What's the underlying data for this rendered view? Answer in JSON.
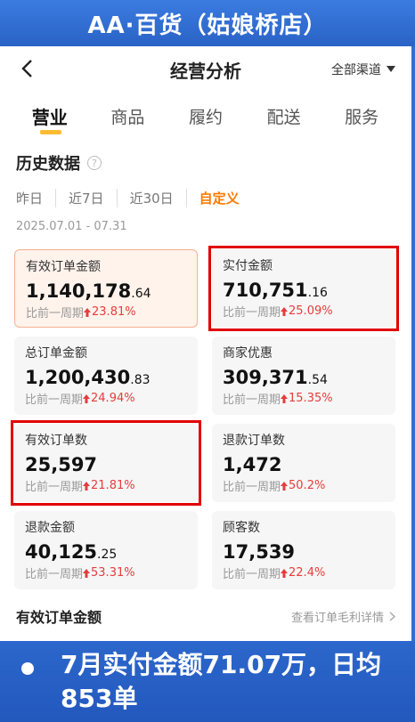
{
  "banner": {
    "title": "AA·百货（姑娘桥店）"
  },
  "nav": {
    "title": "经营分析",
    "channel": "全部渠道"
  },
  "tabs": [
    {
      "label": "营业",
      "active": true
    },
    {
      "label": "商品",
      "active": false
    },
    {
      "label": "履约",
      "active": false
    },
    {
      "label": "配送",
      "active": false
    },
    {
      "label": "服务",
      "active": false
    }
  ],
  "history": {
    "title": "历史数据",
    "ranges": [
      "昨日",
      "近7日",
      "近30日",
      "自定义"
    ],
    "active_range": "自定义",
    "date_range": "2025.07.01 - 07.31"
  },
  "compare_prefix": "比前一周期",
  "metrics": [
    {
      "label": "有效订单金额",
      "value": "1,140,178",
      "decimal": ".64",
      "change": "23.81%"
    },
    {
      "label": "实付金额",
      "value": "710,751",
      "decimal": ".16",
      "change": "25.09%"
    },
    {
      "label": "总订单金额",
      "value": "1,200,430",
      "decimal": ".83",
      "change": "24.94%"
    },
    {
      "label": "商家优惠",
      "value": "309,371",
      "decimal": ".54",
      "change": "15.35%"
    },
    {
      "label": "有效订单数",
      "value": "25,597",
      "decimal": "",
      "change": "21.81%"
    },
    {
      "label": "退款订单数",
      "value": "1,472",
      "decimal": "",
      "change": "50.2%"
    },
    {
      "label": "退款金额",
      "value": "40,125",
      "decimal": ".25",
      "change": "53.31%"
    },
    {
      "label": "顾客数",
      "value": "17,539",
      "decimal": "",
      "change": "22.4%"
    }
  ],
  "footer": {
    "title": "有效订单金额",
    "link": "查看订单毛利详情"
  },
  "caption": {
    "text": "7月实付金额71.07万，日均853单"
  },
  "colors": {
    "accent": "#ff7a00",
    "up": "#e63c3c",
    "highlight_box": "#e10000",
    "banner": "#2f6fd0"
  }
}
